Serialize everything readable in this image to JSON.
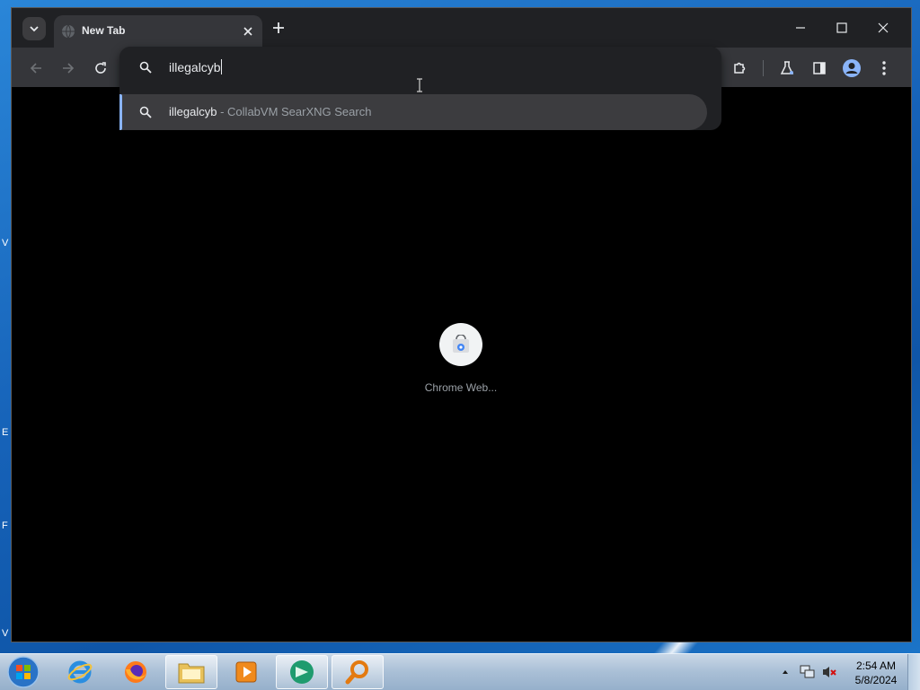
{
  "desktop": {
    "edge_letters": [
      "V",
      "E",
      "F",
      "V"
    ]
  },
  "browser": {
    "tab": {
      "title": "New Tab"
    },
    "omnibox": {
      "value": "illegalcyb",
      "suggestion": {
        "query": "illegalcyb",
        "separator": " - ",
        "engine": "CollabVM SearXNG Search"
      }
    },
    "shortcut": {
      "label": "Chrome Web..."
    }
  },
  "taskbar": {
    "apps": [
      "internet-explorer",
      "firefox",
      "file-explorer",
      "media-player",
      "chrome-style-browser",
      "search-tool"
    ],
    "clock": {
      "time": "2:54 AM",
      "date": "5/8/2024"
    }
  },
  "colors": {
    "chrome_frame": "#202124",
    "chrome_toolbar": "#35363a",
    "accent": "#8ab4f8",
    "page_bg": "#000000"
  }
}
